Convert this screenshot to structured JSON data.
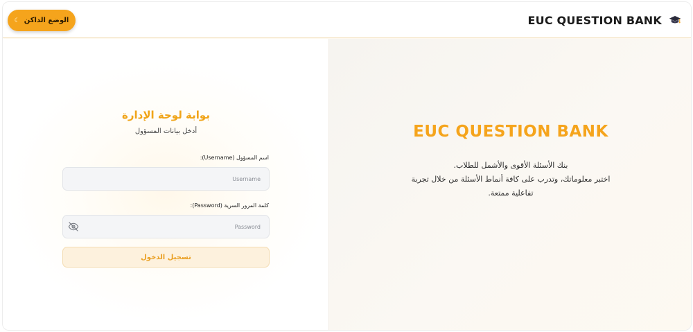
{
  "header": {
    "brand_title": "EUC QUESTION BANK",
    "brand_icon": "graduation-cap-icon",
    "theme_toggle_label": "الوضع الداكن",
    "theme_toggle_icon": "moon-icon"
  },
  "login": {
    "title": "بوابة لوحة الإدارة",
    "subtitle": "أدخل بيانات المسؤول",
    "username_label": "اسم المسؤول (Username):",
    "username_placeholder": "Username",
    "password_label": "كلمة المرور السرية (Password):",
    "password_placeholder": "Password",
    "password_toggle_icon": "eye-off-icon",
    "submit_label": "تسجيل الدخول"
  },
  "hero": {
    "title": "EUC QUESTION BANK",
    "line1": "بنك الأسئلة الأقوى والأشمل للطلاب.",
    "line2": "اختبر معلوماتك، وتدرب على كافة أنماط الأسئلة من خلال تجربة",
    "line3": "تفاعلية ممتعة."
  },
  "colors": {
    "accent": "#f5a41c",
    "accent_text": "#f0a418",
    "button_soft_bg": "#fdf1dd"
  }
}
